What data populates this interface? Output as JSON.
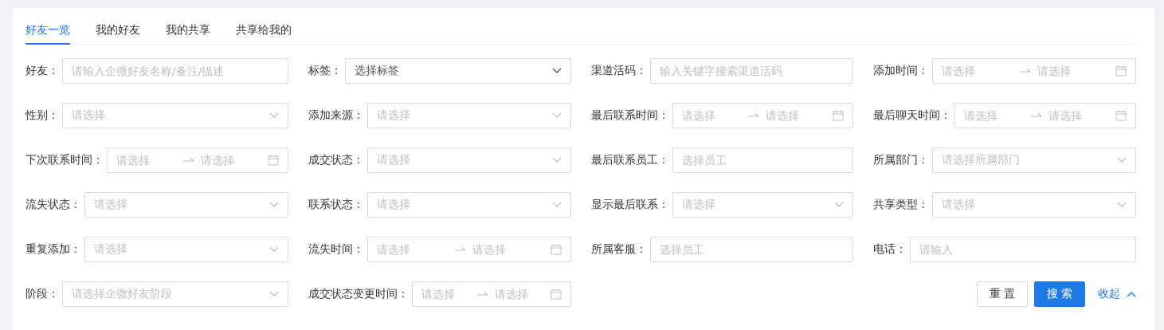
{
  "tabs": [
    {
      "label": "好友一览",
      "selected": true
    },
    {
      "label": "我的好友",
      "selected": false
    },
    {
      "label": "我的共享",
      "selected": false
    },
    {
      "label": "共享给我的",
      "selected": false
    }
  ],
  "filters": [
    {
      "label": "好友：",
      "kind": "text",
      "placeholder": "请输入企微好友名称/备注/描述"
    },
    {
      "label": "标签：",
      "kind": "select",
      "value": "选择标签"
    },
    {
      "label": "渠道活码：",
      "kind": "text",
      "placeholder": "输入关键字搜索渠道活码"
    },
    {
      "label": "添加时间：",
      "kind": "daterange",
      "start_placeholder": "请选择",
      "end_placeholder": "请选择"
    },
    {
      "label": "性别：",
      "kind": "select",
      "placeholder": "请选择"
    },
    {
      "label": "添加来源：",
      "kind": "select",
      "placeholder": "请选择"
    },
    {
      "label": "最后联系时间：",
      "kind": "daterange",
      "start_placeholder": "请选择",
      "end_placeholder": "请选择"
    },
    {
      "label": "最后聊天时间：",
      "kind": "daterange",
      "start_placeholder": "请选择",
      "end_placeholder": "请选择"
    },
    {
      "label": "下次联系时间：",
      "kind": "daterange",
      "start_placeholder": "请选择",
      "end_placeholder": "请选择"
    },
    {
      "label": "成交状态：",
      "kind": "select",
      "placeholder": "请选择"
    },
    {
      "label": "最后联系员工：",
      "kind": "text",
      "placeholder": "选择员工"
    },
    {
      "label": "所属部门：",
      "kind": "select",
      "placeholder": "请选择所属部门"
    },
    {
      "label": "流失状态：",
      "kind": "select",
      "placeholder": "请选择"
    },
    {
      "label": "联系状态：",
      "kind": "select",
      "placeholder": "请选择"
    },
    {
      "label": "显示最后联系：",
      "kind": "select",
      "placeholder": "请选择"
    },
    {
      "label": "共享类型：",
      "kind": "select",
      "placeholder": "请选择"
    },
    {
      "label": "重复添加：",
      "kind": "select",
      "placeholder": "请选择"
    },
    {
      "label": "流失时间：",
      "kind": "daterange",
      "start_placeholder": "请选择",
      "end_placeholder": "请选择"
    },
    {
      "label": "所属客服：",
      "kind": "text",
      "placeholder": "选择员工"
    },
    {
      "label": "电话：",
      "kind": "text",
      "placeholder": "请输入"
    },
    {
      "label": "阶段：",
      "kind": "select",
      "placeholder": "请选择企微好友阶段"
    },
    {
      "label": "成交状态变更时间：",
      "kind": "daterange",
      "start_placeholder": "请选择",
      "end_placeholder": "请选择"
    }
  ],
  "actions": {
    "reset": "重置",
    "search": "搜索",
    "collapse": "收起"
  }
}
